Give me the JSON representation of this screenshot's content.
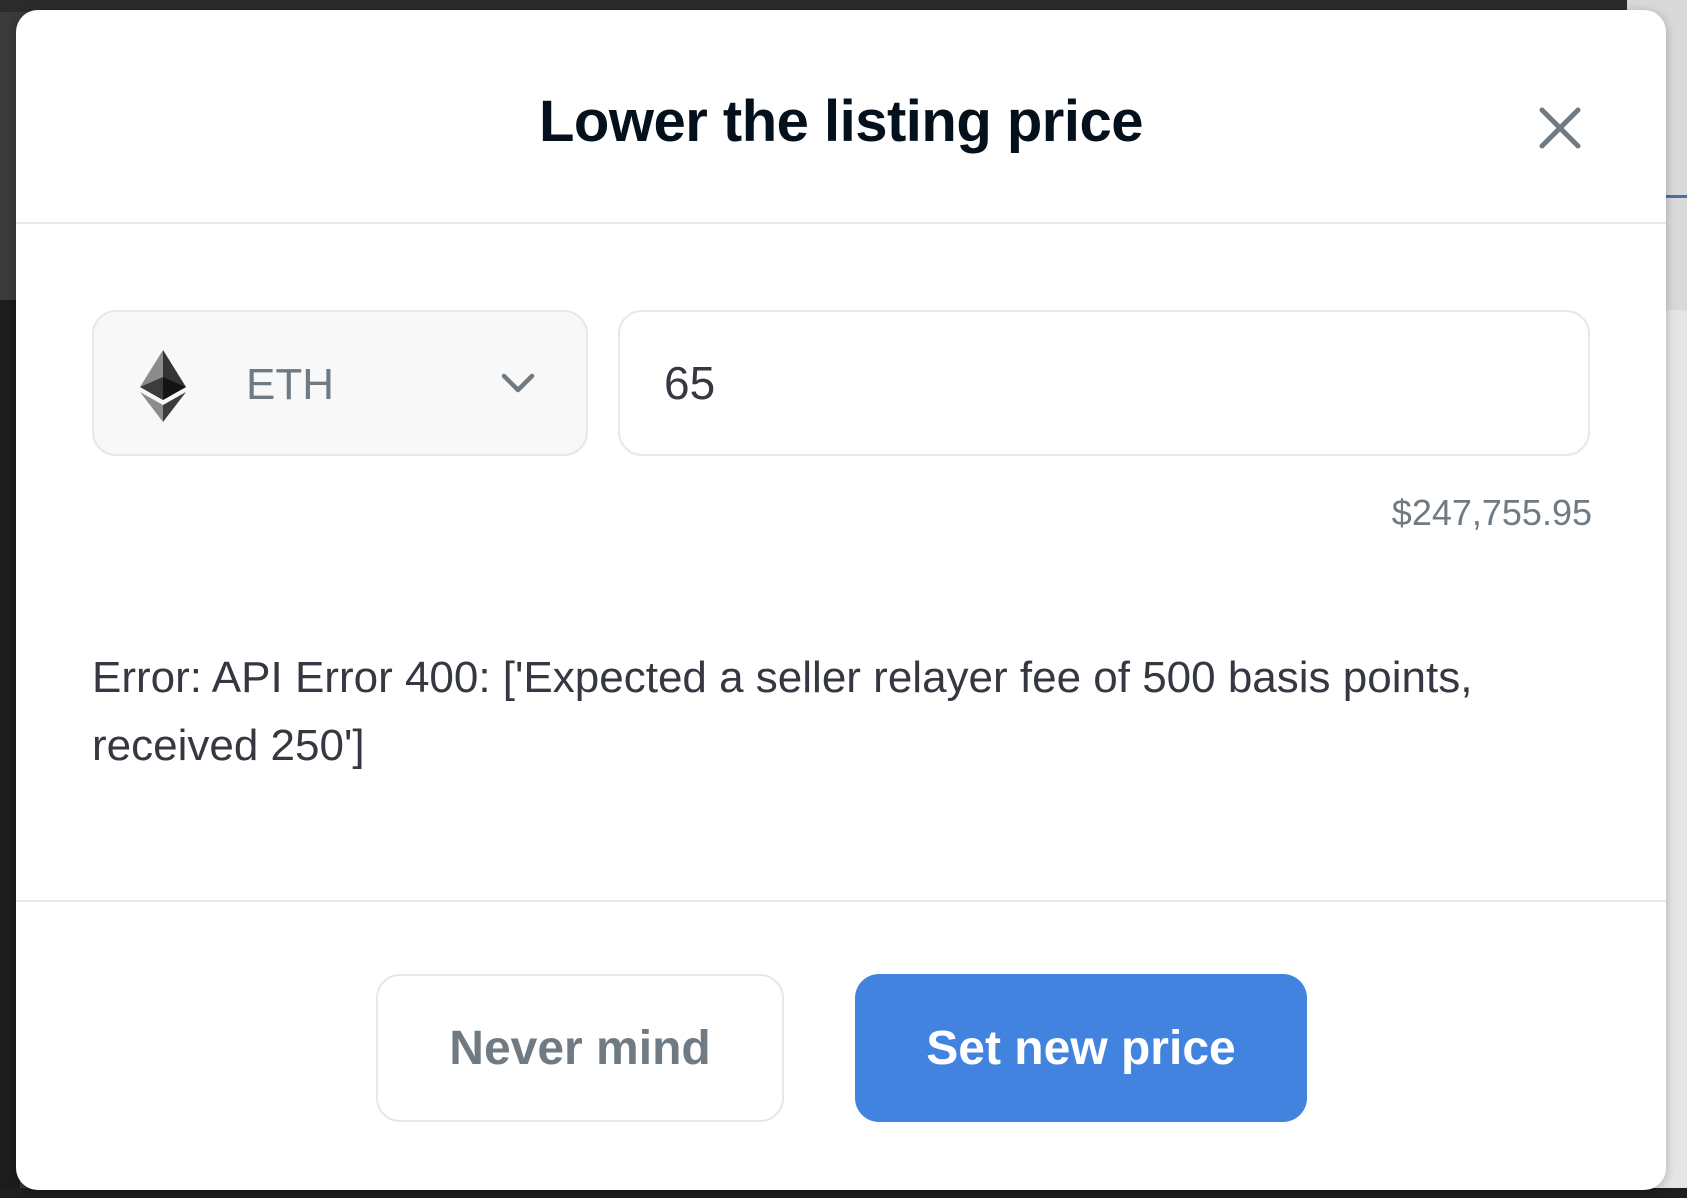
{
  "modal": {
    "title": "Lower the listing price",
    "close_icon": "close-icon"
  },
  "form": {
    "currency": {
      "icon": "ethereum-icon",
      "label": "ETH"
    },
    "price_value": "65",
    "usd_value": "$247,755.95"
  },
  "error": {
    "message": "Error: API Error 400: ['Expected a seller relayer fee of 500 basis points, received 250']"
  },
  "footer": {
    "cancel_label": "Never mind",
    "confirm_label": "Set new price"
  },
  "colors": {
    "primary": "#4383e0",
    "title": "#04111d",
    "muted": "#707a83",
    "border": "#e5e8eb"
  }
}
